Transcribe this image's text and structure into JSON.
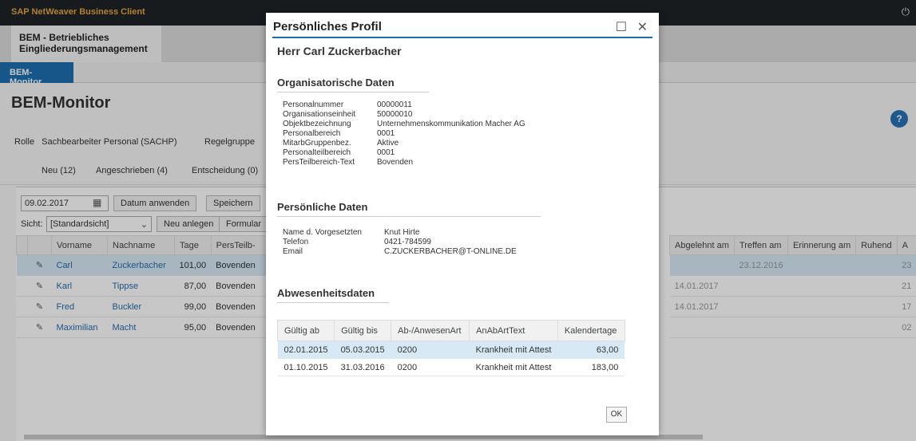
{
  "app": {
    "title": "SAP NetWeaver Business Client",
    "power_icon": "⏻"
  },
  "header": {
    "tab_line1": "BEM - Betriebliches",
    "tab_line2": "Eingliederungsmanagement"
  },
  "nav": {
    "active_tab": "BEM-Monitor"
  },
  "page": {
    "title": "BEM-Monitor",
    "rolle_label": "Rolle",
    "rolle_value": "Sachbearbeiter Personal (SACHP)",
    "regelgruppe_label": "Regelgruppe",
    "tabs": [
      "Neu (12)",
      "Angeschrieben (4)",
      "Entscheidung (0)"
    ],
    "date_value": "09.02.2017",
    "btn_apply_date": "Datum anwenden",
    "btn_save": "Speichern",
    "sicht_label": "Sicht:",
    "sicht_value": "[Standardsicht]",
    "btn_new": "Neu anlegen",
    "btn_form": "Formular"
  },
  "grid": {
    "headers": [
      "Vorname",
      "Nachname",
      "Tage",
      "PersTeilb-"
    ],
    "rows": [
      {
        "vorname": "Carl",
        "nachname": "Zuckerbacher",
        "tage": "101,00",
        "pers": "Bovenden"
      },
      {
        "vorname": "Karl",
        "nachname": "Tippse",
        "tage": "87,00",
        "pers": "Bovenden"
      },
      {
        "vorname": "Fred",
        "nachname": "Buckler",
        "tage": "99,00",
        "pers": "Bovenden"
      },
      {
        "vorname": "Maximilian",
        "nachname": "Macht",
        "tage": "95,00",
        "pers": "Bovenden"
      }
    ]
  },
  "grid_right": {
    "headers": [
      "Abgelehnt am",
      "Treffen am",
      "Erinnerung am",
      "Ruhend",
      "A"
    ],
    "rows": [
      {
        "abgelehnt": "",
        "treffen": "23.12.2016",
        "a": "23"
      },
      {
        "abgelehnt": "14.01.2017",
        "treffen": "",
        "a": "21"
      },
      {
        "abgelehnt": "14.01.2017",
        "treffen": "",
        "a": "17"
      },
      {
        "abgelehnt": "",
        "treffen": "",
        "a": "02"
      }
    ]
  },
  "dialog": {
    "title": "Persönliches Profil",
    "person": "Herr Carl Zuckerbacher",
    "org_section": "Organisatorische Daten",
    "org": [
      {
        "k": "Personalnummer",
        "v": "00000011"
      },
      {
        "k": "Organisationseinheit",
        "v": "50000010"
      },
      {
        "k": "Objektbezeichnung",
        "v": "Unternehmenskommunikation Macher AG"
      },
      {
        "k": "Personalbereich",
        "v": "0001"
      },
      {
        "k": "MitarbGruppenbez.",
        "v": "Aktive"
      },
      {
        "k": "Personalteilbereich",
        "v": "0001"
      },
      {
        "k": "PersTeilbereich-Text",
        "v": "Bovenden"
      }
    ],
    "pers_section": "Persönliche Daten",
    "pers": [
      {
        "k": "Name d. Vorgesetzten",
        "v": "Knut Hirte"
      },
      {
        "k": "Telefon",
        "v": "0421-784599"
      },
      {
        "k": "Email",
        "v": "C.ZUCKERBACHER@T-ONLINE.DE"
      }
    ],
    "abs_section": "Abwesenheitsdaten",
    "abs_headers": [
      "Gültig ab",
      "Gültig bis",
      "Ab-/AnwesenArt",
      "AnAbArtText",
      "Kalendertage"
    ],
    "abs_rows": [
      [
        "02.01.2015",
        "05.03.2015",
        "0200",
        "Krankheit mit Attest",
        "63,00"
      ],
      [
        "01.10.2015",
        "31.03.2016",
        "0200",
        "Krankheit mit Attest",
        "183,00"
      ]
    ],
    "ok": "OK"
  }
}
